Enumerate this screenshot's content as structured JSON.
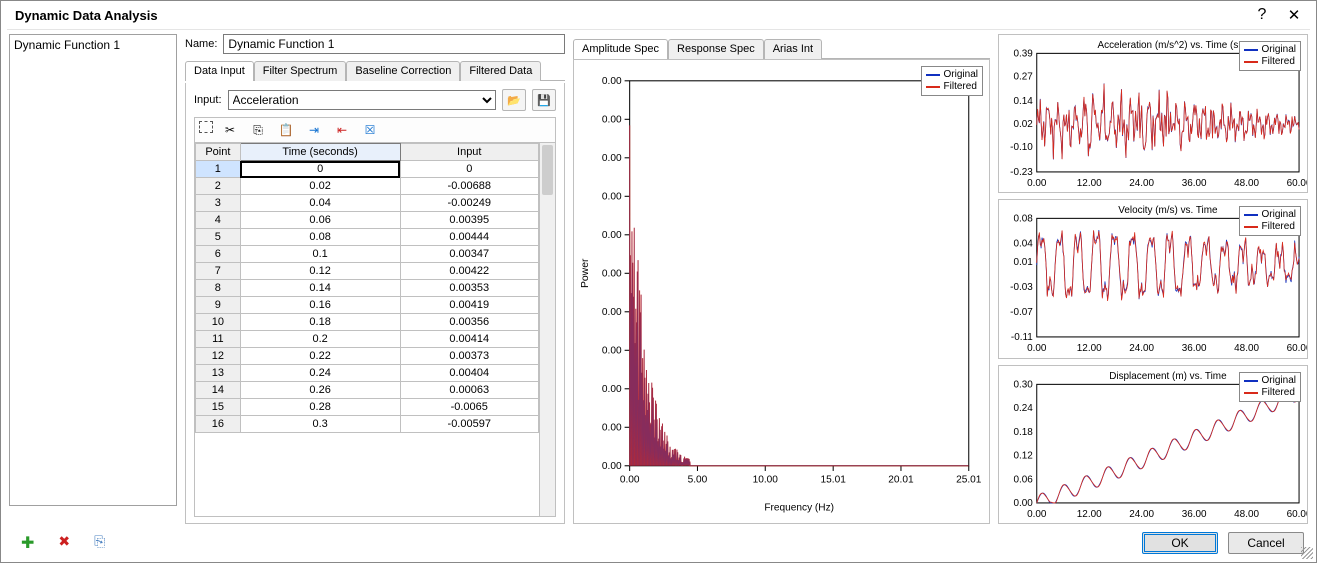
{
  "window_title": "Dynamic Data Analysis",
  "tree_item": "Dynamic Function 1",
  "name_label": "Name:",
  "name_value": "Dynamic Function 1",
  "mid_tabs": [
    "Data Input",
    "Filter Spectrum",
    "Baseline Correction",
    "Filtered Data"
  ],
  "input_label": "Input:",
  "input_combo": "Acceleration",
  "table": {
    "headers": [
      "Point",
      "Time (seconds)",
      "Input"
    ],
    "rows": [
      [
        "1",
        "0",
        "0"
      ],
      [
        "2",
        "0.02",
        "-0.00688"
      ],
      [
        "3",
        "0.04",
        "-0.00249"
      ],
      [
        "4",
        "0.06",
        "0.00395"
      ],
      [
        "5",
        "0.08",
        "0.00444"
      ],
      [
        "6",
        "0.1",
        "0.00347"
      ],
      [
        "7",
        "0.12",
        "0.00422"
      ],
      [
        "8",
        "0.14",
        "0.00353"
      ],
      [
        "9",
        "0.16",
        "0.00419"
      ],
      [
        "10",
        "0.18",
        "0.00356"
      ],
      [
        "11",
        "0.2",
        "0.00414"
      ],
      [
        "12",
        "0.22",
        "0.00373"
      ],
      [
        "13",
        "0.24",
        "0.00404"
      ],
      [
        "14",
        "0.26",
        "0.00063"
      ],
      [
        "15",
        "0.28",
        "-0.0065"
      ],
      [
        "16",
        "0.3",
        "-0.00597"
      ]
    ]
  },
  "center_tabs": [
    "Amplitude Spec",
    "Response Spec",
    "Arias Int"
  ],
  "legend": {
    "series1": "Original",
    "series2": "Filtered",
    "color1": "#1030c0",
    "color2": "#d82a1a"
  },
  "buttons": {
    "ok": "OK",
    "cancel": "Cancel"
  },
  "chart_data": [
    {
      "type": "line",
      "title": "",
      "ylabel": "Power",
      "xlabel": "Frequency (Hz)",
      "x_ticks": [
        0.0,
        5.0,
        10.0,
        15.01,
        20.01,
        25.01
      ],
      "y_ticks": [
        0.0,
        0.0,
        0.0,
        0.0,
        0.0,
        0.0,
        0.0,
        0.0,
        0.0,
        0.0,
        0.0
      ],
      "xlim": [
        0,
        25.01
      ],
      "ylim": [
        0,
        1
      ],
      "note": "Narrow spectral peaks below ~3 Hz, near-zero beyond 5 Hz",
      "series": [
        {
          "name": "Original",
          "color": "#1030c0",
          "x": [
            0.0,
            0.5,
            1.0,
            1.3,
            1.6,
            2.0,
            2.5,
            3.0,
            4.0,
            5.0,
            25.0
          ],
          "y": [
            0.0,
            0.55,
            0.35,
            1.0,
            0.78,
            0.42,
            0.28,
            0.12,
            0.04,
            0.01,
            0.0
          ]
        },
        {
          "name": "Filtered",
          "color": "#d82a1a",
          "x": [
            0.0,
            0.5,
            1.0,
            1.3,
            1.6,
            2.0,
            2.5,
            3.0,
            4.0,
            5.0,
            25.0
          ],
          "y": [
            0.0,
            0.55,
            0.35,
            1.0,
            0.78,
            0.42,
            0.28,
            0.12,
            0.04,
            0.01,
            0.0
          ]
        }
      ]
    },
    {
      "type": "line",
      "title": "Acceleration (m/s^2) vs. Time (s",
      "xlabel": "",
      "ylabel": "",
      "x_ticks": [
        0.0,
        12.0,
        24.0,
        36.0,
        48.0,
        60.0
      ],
      "y_ticks": [
        -0.23,
        -0.1,
        0.02,
        0.14,
        0.27,
        0.39
      ],
      "xlim": [
        0,
        60
      ],
      "ylim": [
        -0.23,
        0.39
      ],
      "series": [
        {
          "name": "Original",
          "color": "#1030c0"
        },
        {
          "name": "Filtered",
          "color": "#d82a1a"
        }
      ],
      "note": "Dense noisy signal, peak ~0.39 near t≈14s"
    },
    {
      "type": "line",
      "title": "Velocity (m/s) vs. Time",
      "xlabel": "",
      "ylabel": "",
      "x_ticks": [
        0.0,
        12.0,
        24.0,
        36.0,
        48.0,
        60.0
      ],
      "y_ticks": [
        -0.11,
        -0.07,
        -0.03,
        0.01,
        0.04,
        0.08
      ],
      "xlim": [
        0,
        60
      ],
      "ylim": [
        -0.11,
        0.08
      ],
      "series": [
        {
          "name": "Original",
          "color": "#1030c0"
        },
        {
          "name": "Filtered",
          "color": "#d82a1a"
        }
      ]
    },
    {
      "type": "line",
      "title": "Displacement (m) vs. Time",
      "xlabel": "",
      "ylabel": "",
      "x_ticks": [
        0.0,
        12.0,
        24.0,
        36.0,
        48.0,
        60.0
      ],
      "y_ticks": [
        -0.0,
        0.06,
        0.12,
        0.18,
        0.24,
        0.3
      ],
      "xlim": [
        0,
        60
      ],
      "ylim": [
        0,
        0.3
      ],
      "series": [
        {
          "name": "Original",
          "color": "#1030c0"
        },
        {
          "name": "Filtered",
          "color": "#d82a1a"
        }
      ],
      "note": "Monotonically increasing wavy curve from 0 to ~0.28"
    }
  ]
}
